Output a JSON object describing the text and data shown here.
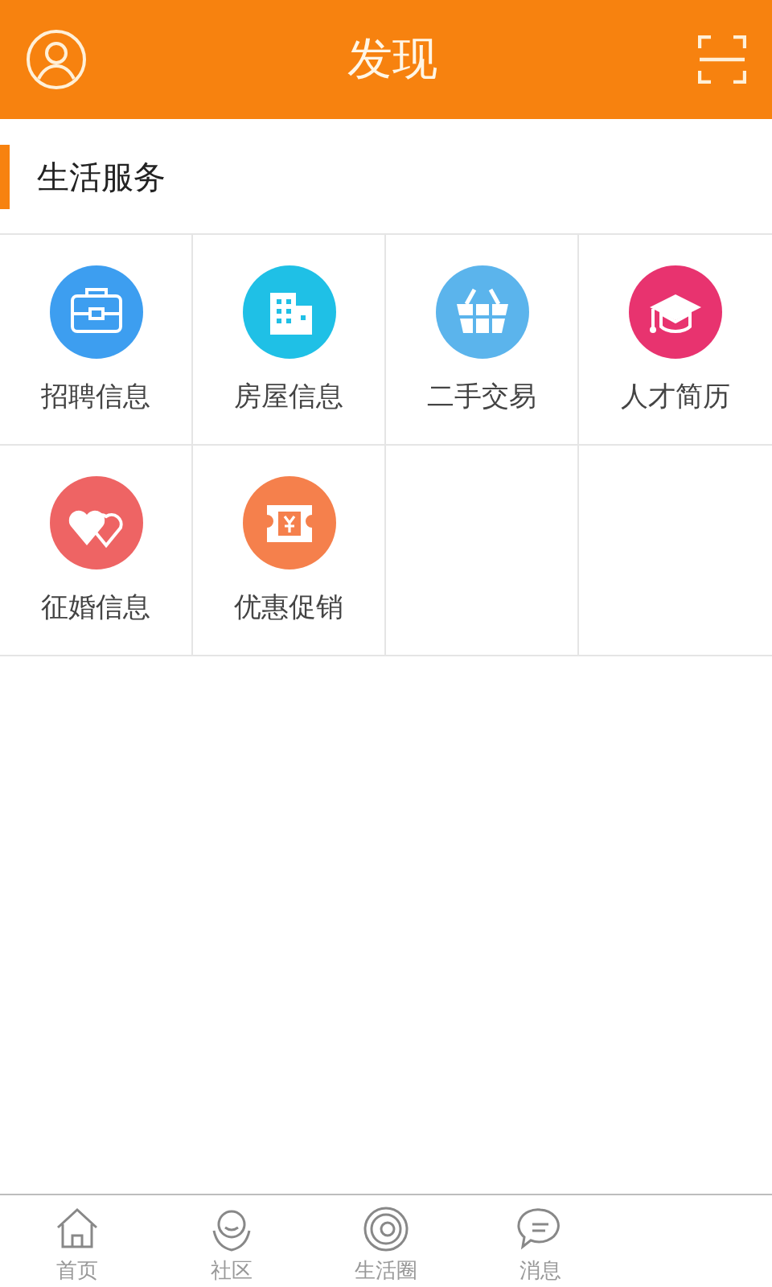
{
  "header": {
    "title": "发现"
  },
  "section": {
    "title": "生活服务"
  },
  "services": [
    {
      "label": "招聘信息",
      "color": "#3d9ef0"
    },
    {
      "label": "房屋信息",
      "color": "#1fc0e6"
    },
    {
      "label": "二手交易",
      "color": "#5bb4ec"
    },
    {
      "label": "人才简历",
      "color": "#e8336f"
    },
    {
      "label": "征婚信息",
      "color": "#ee6464"
    },
    {
      "label": "优惠促销",
      "color": "#f5804c"
    }
  ],
  "tab_bar": [
    {
      "label": "首页"
    },
    {
      "label": "社区"
    },
    {
      "label": "生活圈"
    },
    {
      "label": "消息"
    }
  ]
}
